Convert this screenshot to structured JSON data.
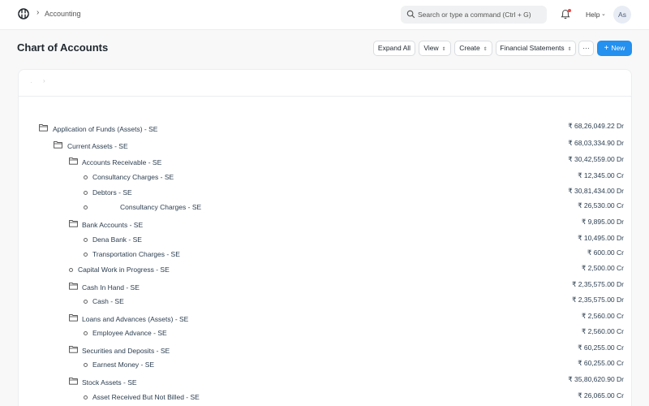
{
  "nav": {
    "breadcrumb": "Accounting",
    "search_placeholder": "Search or type a command (Ctrl + G)",
    "help": "Help",
    "avatar": "As"
  },
  "page": {
    "title": "Chart of Accounts",
    "buttons": {
      "expand_all": "Expand All",
      "view": "View",
      "create": "Create",
      "financial_statements": "Financial Statements",
      "more": "···",
      "new": "New"
    }
  },
  "tree": [
    {
      "label": "Application of Funds (Assets) - SE",
      "balance": "₹ 68,26,049.22 Dr",
      "kind": "folder"
    },
    {
      "label": "Current Assets - SE",
      "balance": "₹ 68,03,334.90 Dr",
      "kind": "folder"
    },
    {
      "label": "Accounts Receivable - SE",
      "balance": "₹ 30,42,559.00 Dr",
      "kind": "folder"
    },
    {
      "label": "Consultancy Charges - SE",
      "balance": "₹ 12,345.00 Cr",
      "kind": "leaf"
    },
    {
      "label": "Debtors - SE",
      "balance": "₹ 30,81,434.00 Dr",
      "kind": "leaf"
    },
    {
      "label": "Consultancy Charges - SE",
      "balance": "₹ 26,530.00 Cr",
      "kind": "leaf"
    },
    {
      "label": "Bank Accounts - SE",
      "balance": "₹ 9,895.00 Dr",
      "kind": "folder"
    },
    {
      "label": "Dena Bank - SE",
      "balance": "₹ 10,495.00 Dr",
      "kind": "leaf"
    },
    {
      "label": "Transportation Charges - SE",
      "balance": "₹ 600.00 Cr",
      "kind": "leaf"
    },
    {
      "label": "Capital Work in Progress - SE",
      "balance": "₹ 2,500.00 Cr",
      "kind": "leaf"
    },
    {
      "label": "Cash In Hand - SE",
      "balance": "₹ 2,35,575.00 Dr",
      "kind": "folder"
    },
    {
      "label": "Cash - SE",
      "balance": "₹ 2,35,575.00 Dr",
      "kind": "leaf"
    },
    {
      "label": "Loans and Advances (Assets) - SE",
      "balance": "₹ 2,560.00 Cr",
      "kind": "folder"
    },
    {
      "label": "Employee Advance - SE",
      "balance": "₹ 2,560.00 Cr",
      "kind": "leaf"
    },
    {
      "label": "Securities and Deposits - SE",
      "balance": "₹ 60,255.00 Cr",
      "kind": "folder"
    },
    {
      "label": "Earnest Money - SE",
      "balance": "₹ 60,255.00 Cr",
      "kind": "leaf"
    },
    {
      "label": "Stock Assets - SE",
      "balance": "₹ 35,80,620.90 Dr",
      "kind": "folder"
    },
    {
      "label": "Asset Received But Not Billed - SE",
      "balance": "₹ 26,065.00 Cr",
      "kind": "leaf"
    }
  ],
  "colors": {
    "primary": "#2490ef",
    "text": "#1f272e",
    "notification": "#e24c4c"
  }
}
